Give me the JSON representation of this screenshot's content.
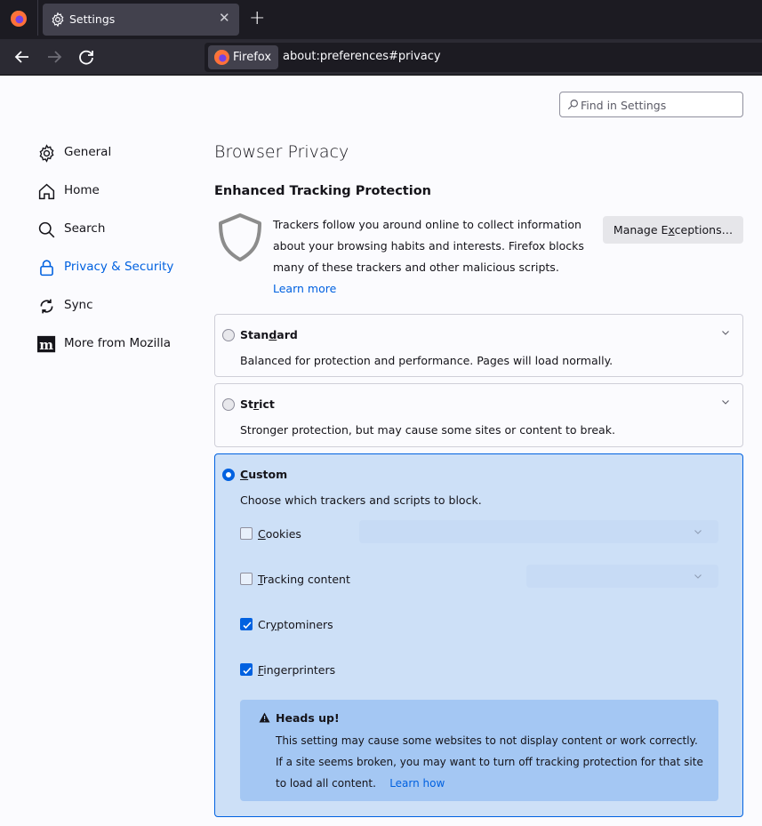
{
  "browser": {
    "tab_title": "Settings",
    "identity_label": "Firefox",
    "url": "about:preferences#privacy"
  },
  "search": {
    "placeholder": "Find in Settings",
    "value": ""
  },
  "sidebar": {
    "items": [
      {
        "label": "General",
        "icon": "gear-icon"
      },
      {
        "label": "Home",
        "icon": "home-icon"
      },
      {
        "label": "Search",
        "icon": "search-icon"
      },
      {
        "label": "Privacy & Security",
        "icon": "lock-icon",
        "selected": true
      },
      {
        "label": "Sync",
        "icon": "sync-icon"
      },
      {
        "label": "More from Mozilla",
        "icon": "mozilla-icon"
      }
    ]
  },
  "main": {
    "page_title": "Browser Privacy",
    "section_title": "Enhanced Tracking Protection",
    "etp_description": "Trackers follow you around online to collect information about your browsing habits and interests. Firefox blocks many of these trackers and other malicious scripts.",
    "learn_more": "Learn more",
    "manage_exceptions": {
      "pre": "Manage E",
      "accel": "x",
      "post": "ceptions…"
    },
    "modes": {
      "standard": {
        "pre": "Stan",
        "accel": "d",
        "post": "ard",
        "description": "Balanced for protection and performance. Pages will load normally.",
        "selected": false
      },
      "strict": {
        "pre": "St",
        "accel": "r",
        "post": "ict",
        "description": "Stronger protection, but may cause some sites or content to break.",
        "selected": false
      },
      "custom": {
        "pre": "",
        "accel": "C",
        "post": "ustom",
        "description": "Choose which trackers and scripts to block.",
        "selected": true
      }
    },
    "custom_options": [
      {
        "pre": "",
        "accel": "C",
        "post": "ookies",
        "checked": false,
        "select_value": ""
      },
      {
        "pre": "",
        "accel": "T",
        "post": "racking content",
        "checked": false,
        "select_value": ""
      },
      {
        "pre": "Cr",
        "accel": "y",
        "post": "ptominers",
        "checked": true
      },
      {
        "pre": "",
        "accel": "F",
        "post": "ingerprinters",
        "checked": true
      }
    ],
    "warning": {
      "title": "Heads up!",
      "text": "This setting may cause some websites to not display content or work correctly. If a site seems broken, you may want to turn off tracking protection for that site to load all content.",
      "link": "Learn how"
    }
  },
  "colors": {
    "accent": "#0061e0",
    "custom_card_bg": "#cde0f7",
    "warning_bg": "#a4c7f3"
  }
}
